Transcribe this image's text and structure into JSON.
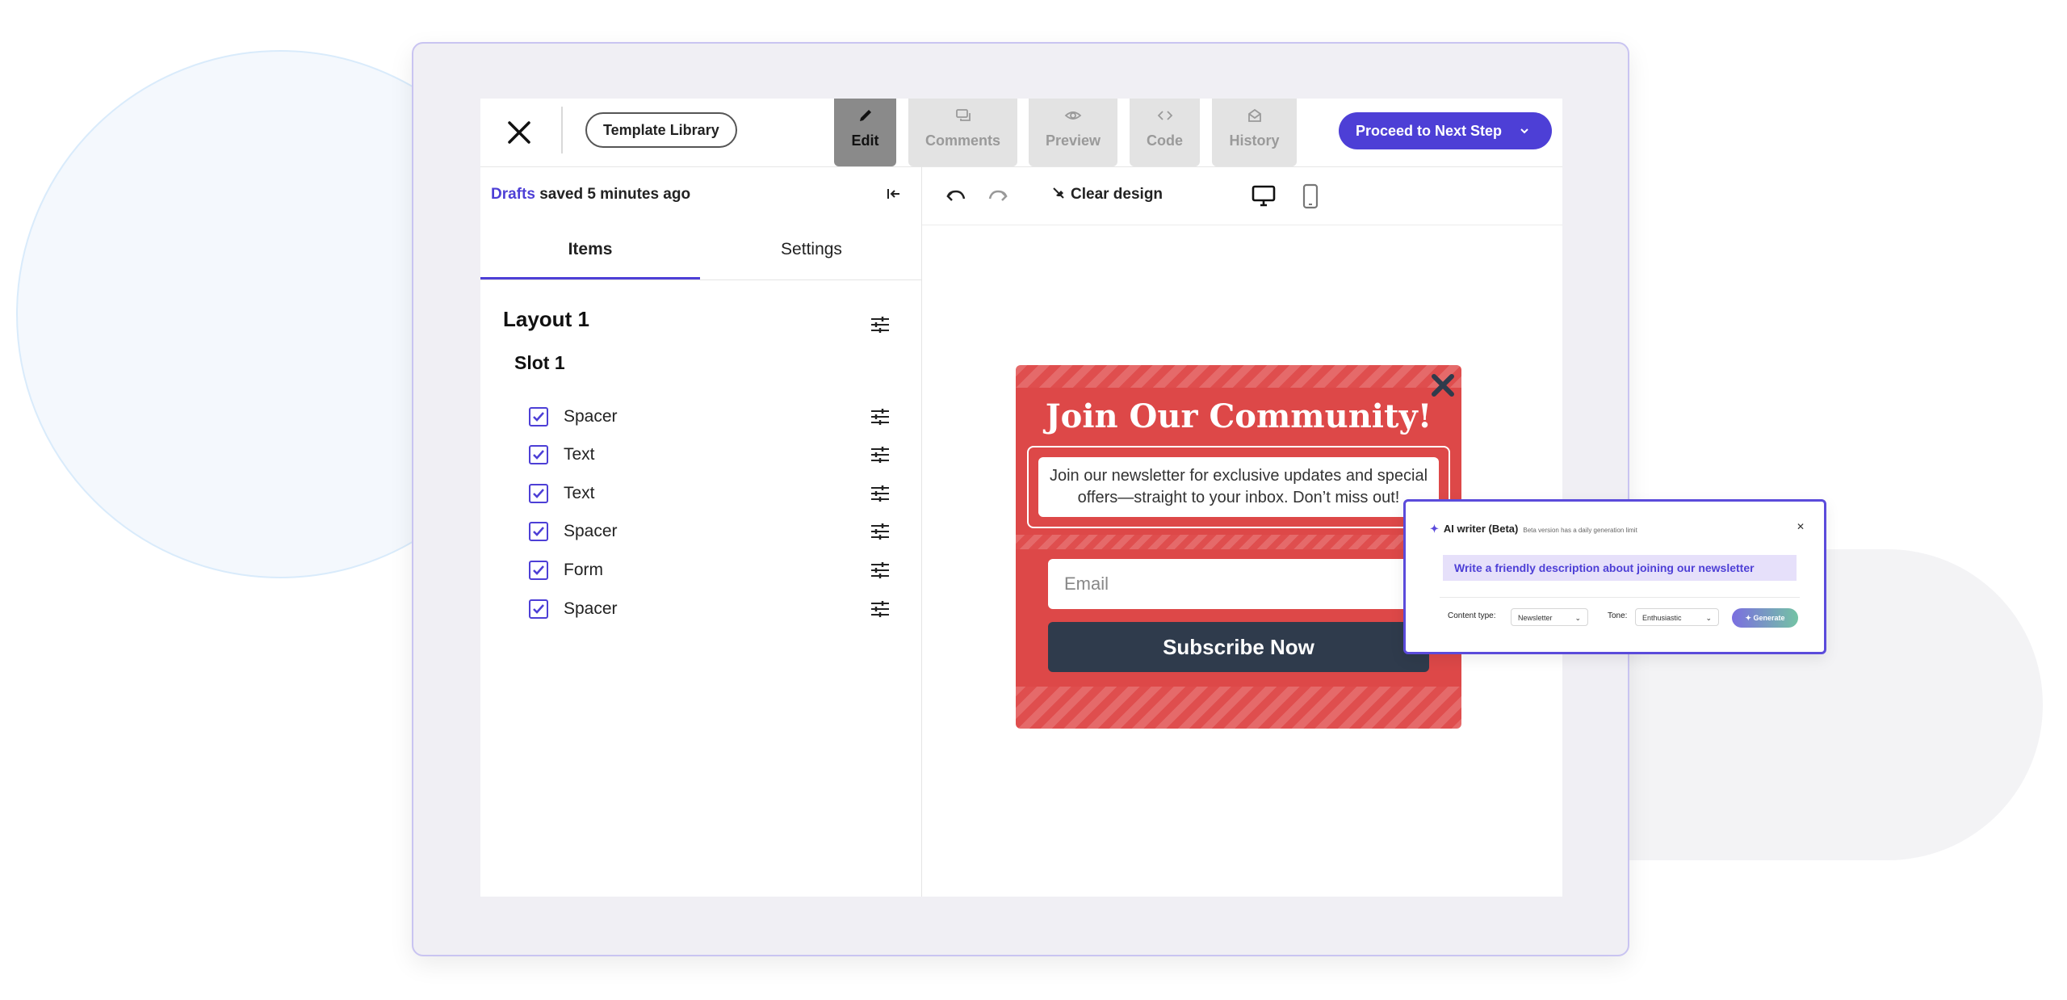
{
  "topbar": {
    "template_library": "Template Library",
    "tabs": [
      {
        "label": "Edit",
        "icon": "pencil-icon",
        "active": true
      },
      {
        "label": "Comments",
        "icon": "comments-icon",
        "active": false
      },
      {
        "label": "Preview",
        "icon": "eye-icon",
        "active": false
      },
      {
        "label": "Code",
        "icon": "code-icon",
        "active": false
      },
      {
        "label": "History",
        "icon": "history-icon",
        "active": false
      }
    ],
    "proceed_label": "Proceed to Next Step"
  },
  "left_panel": {
    "drafts_link": "Drafts",
    "drafts_status": "saved 5 minutes ago",
    "tabs": [
      {
        "label": "Items",
        "active": true
      },
      {
        "label": "Settings",
        "active": false
      }
    ],
    "layout_title": "Layout 1",
    "slot_title": "Slot 1",
    "items": [
      {
        "label": "Spacer",
        "checked": true
      },
      {
        "label": "Text",
        "checked": true
      },
      {
        "label": "Text",
        "checked": true
      },
      {
        "label": "Spacer",
        "checked": true
      },
      {
        "label": "Form",
        "checked": true
      },
      {
        "label": "Spacer",
        "checked": true
      }
    ]
  },
  "toolbar": {
    "clear_design": "Clear design"
  },
  "popup": {
    "title": "Join Our Community!",
    "description": "Join our newsletter for exclusive updates and special offers—straight to your inbox. Don’t miss out!",
    "email_placeholder": "Email",
    "submit_label": "Subscribe Now"
  },
  "ai_writer": {
    "title": "AI writer (Beta)",
    "note": "Beta version has a daily generation limit",
    "prompt": "Write a friendly description about joining our newsletter",
    "content_type_label": "Content type:",
    "content_type_value": "Newsletter",
    "tone_label": "Tone:",
    "tone_value": "Enthusiastic",
    "generate_label": "Generate"
  },
  "colors": {
    "accent": "#4d3fd6",
    "popup_red": "#dd4848",
    "submit_dark": "#2f3b4c"
  }
}
